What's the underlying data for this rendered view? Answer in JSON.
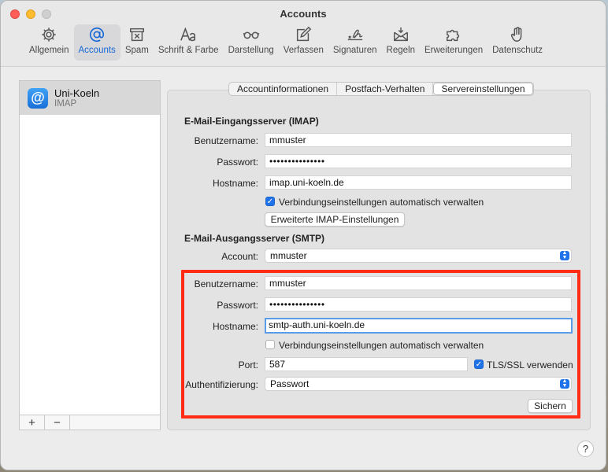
{
  "window": {
    "title": "Accounts"
  },
  "toolbar": {
    "items": [
      {
        "label": "Allgemein",
        "icon": "gear-icon"
      },
      {
        "label": "Accounts",
        "icon": "at-icon"
      },
      {
        "label": "Spam",
        "icon": "trash-box-icon"
      },
      {
        "label": "Schrift & Farbe",
        "icon": "fonts-icon"
      },
      {
        "label": "Darstellung",
        "icon": "glasses-icon"
      },
      {
        "label": "Verfassen",
        "icon": "compose-icon"
      },
      {
        "label": "Signaturen",
        "icon": "signature-icon"
      },
      {
        "label": "Regeln",
        "icon": "rules-envelope-icon"
      },
      {
        "label": "Erweiterungen",
        "icon": "puzzle-icon"
      },
      {
        "label": "Datenschutz",
        "icon": "hand-icon"
      }
    ],
    "active": "Accounts",
    "active_color": "#1668d8"
  },
  "sidebar": {
    "accounts": [
      {
        "name": "Uni-Koeln",
        "type": "IMAP",
        "icon": "at-icon"
      }
    ],
    "add_label": "+",
    "remove_label": "−"
  },
  "tabs": [
    {
      "label": "Accountinformationen"
    },
    {
      "label": "Postfach-Verhalten"
    },
    {
      "label": "Servereinstellungen"
    }
  ],
  "incoming": {
    "title": "E-Mail-Eingangsserver (IMAP)",
    "username_label": "Benutzername:",
    "username": "mmuster",
    "password_label": "Passwort:",
    "password": "•••••••••••••••",
    "hostname_label": "Hostname:",
    "hostname": "imap.uni-koeln.de",
    "auto_manage_label": "Verbindungseinstellungen automatisch verwalten",
    "auto_manage_checked": true,
    "advanced_button": "Erweiterte IMAP-Einstellungen"
  },
  "outgoing": {
    "title": "E-Mail-Ausgangsserver (SMTP)",
    "account_label": "Account:",
    "account": "mmuster",
    "username_label": "Benutzername:",
    "username": "mmuster",
    "password_label": "Passwort:",
    "password": "•••••••••••••••",
    "hostname_label": "Hostname:",
    "hostname": "smtp-auth.uni-koeln.de",
    "auto_manage_label": "Verbindungseinstellungen automatisch verwalten",
    "auto_manage_checked": false,
    "port_label": "Port:",
    "port": "587",
    "tls_label": "TLS/SSL verwenden",
    "tls_checked": true,
    "auth_label": "Authentifizierung:",
    "auth": "Passwort",
    "save_button": "Sichern",
    "highlight_color": "#ff2b14"
  },
  "help_label": "?"
}
